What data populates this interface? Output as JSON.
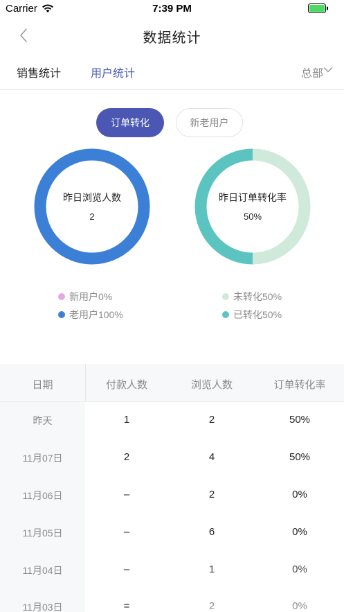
{
  "status_bar": {
    "carrier": "Carrier",
    "time": "7:39 PM",
    "battery_color": "#4cd964"
  },
  "nav": {
    "title": "数据统计"
  },
  "tabs": {
    "sales": "销售统计",
    "users": "用户统计",
    "region": "总部"
  },
  "segments": {
    "active": "订单转化",
    "inactive": "新老用户"
  },
  "donut_left": {
    "title": "昨日浏览人数",
    "value": "2",
    "color": "#3b7fd6",
    "legend": [
      {
        "label": "新用户0%",
        "color": "#e6a8e4",
        "share": 0
      },
      {
        "label": "老用户100%",
        "color": "#3b7fd6",
        "share": 1
      }
    ]
  },
  "donut_right": {
    "title": "昨日订单转化率",
    "value": "50%",
    "legend": [
      {
        "label": "未转化50%",
        "color": "#cfe9da",
        "share": 0.5
      },
      {
        "label": "已转化50%",
        "color": "#5bc4c0",
        "share": 0.5
      }
    ]
  },
  "table": {
    "headers": [
      "日期",
      "付款人数",
      "浏览人数",
      "订单转化率"
    ],
    "rows": [
      [
        "昨天",
        "1",
        "2",
        "50%"
      ],
      [
        "11月07日",
        "2",
        "4",
        "50%"
      ],
      [
        "11月06日",
        "–",
        "2",
        "0%"
      ],
      [
        "11月05日",
        "–",
        "6",
        "0%"
      ],
      [
        "11月04日",
        "–",
        "1",
        "0%"
      ],
      [
        "11月03日",
        "=",
        "2",
        "0%"
      ]
    ]
  }
}
